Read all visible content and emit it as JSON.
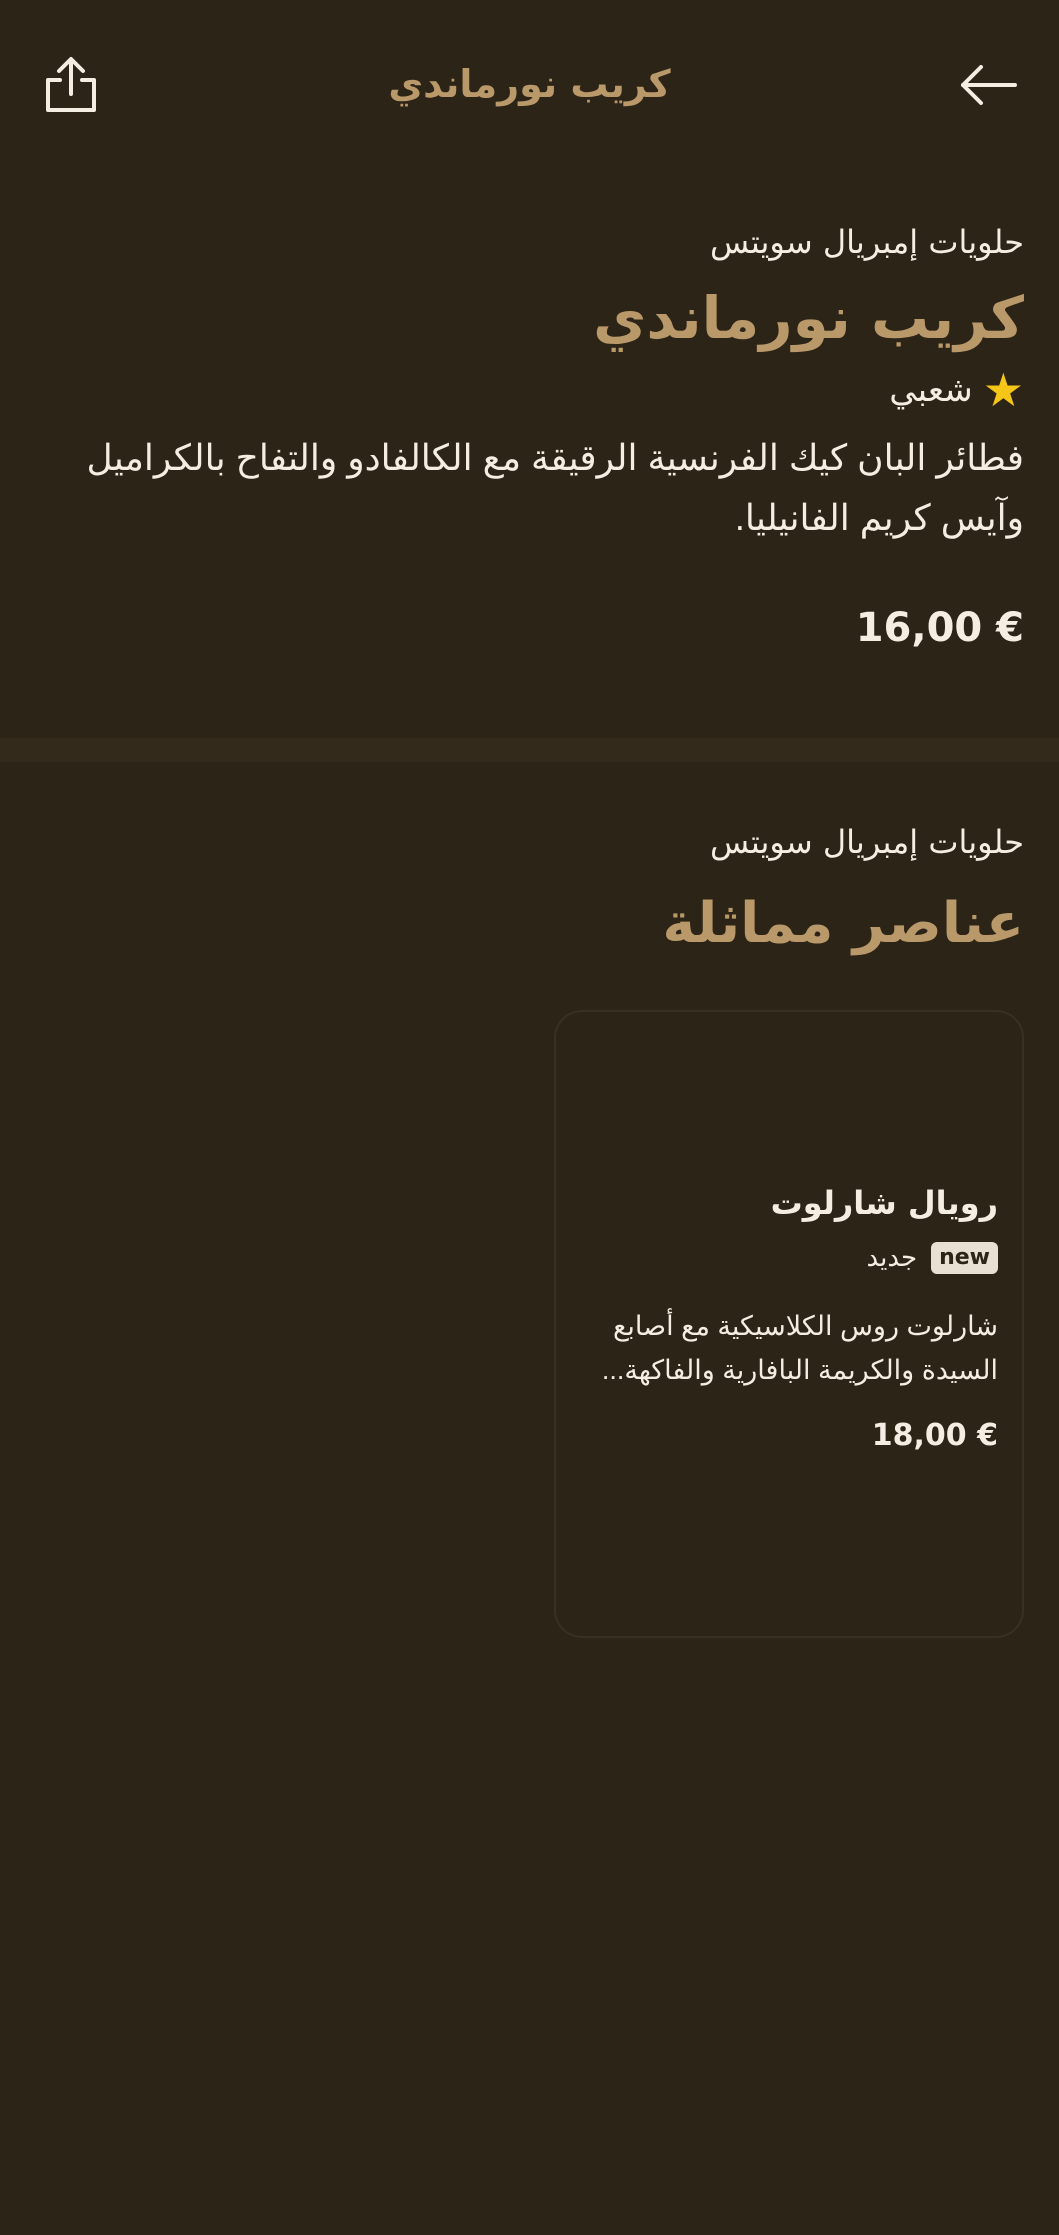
{
  "header": {
    "title": "كريب نورماندي",
    "share_icon": "share-icon",
    "back_icon": "arrow-right-icon"
  },
  "product": {
    "vendor": "حلويات إمبريال سويتس",
    "title": "كريب نورماندي",
    "rating_label": "شعبي",
    "description": "فطائر البان كيك الفرنسية الرقيقة مع الكالفادو والتفاح بالكراميل وآيس كريم الفانيليا.",
    "price": "16,00 €"
  },
  "similar": {
    "vendor": "حلويات إمبريال سويتس",
    "title": "عناصر مماثلة",
    "items": [
      {
        "title": "رويال شارلوت",
        "badge": "new",
        "badge_label": "جديد",
        "description": "شارلوت روس الكلاسيكية مع أصابع السيدة والكريمة البافارية والفاكهة...",
        "price": "18,00 €"
      }
    ]
  },
  "colors": {
    "background": "#2c2417",
    "accent": "#b99869",
    "text": "#f4ede2",
    "star": "#f5c518"
  }
}
